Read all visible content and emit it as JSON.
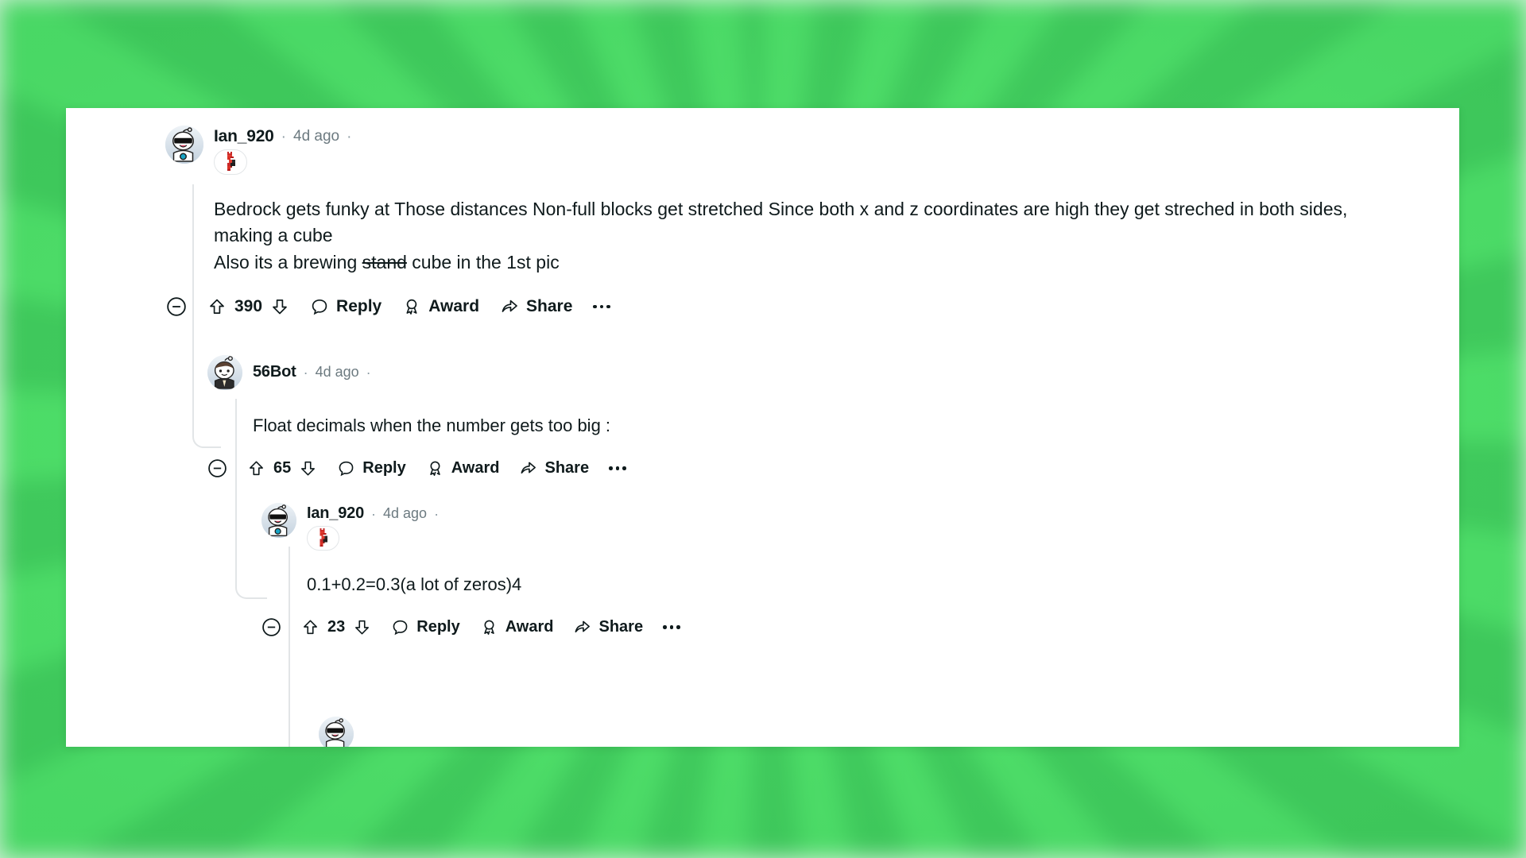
{
  "theme": {
    "background_color": "#41c95d",
    "card_color": "#ffffff",
    "text_color": "#0f1a1c",
    "muted_text_color": "#6c7a80",
    "thread_line_color": "#e2e5e7"
  },
  "comments": [
    {
      "id": "comment-1",
      "author": "Ian_920",
      "separator": "·",
      "timestamp": "4d ago",
      "trailing_separator": "·",
      "flair_icon": "minecraft-redstone-torch-icon",
      "avatar_icon": "snoo-sunglasses-avatar",
      "paragraphs": [
        {
          "before": "Bedrock gets funky at Those distances Non-full blocks get stretched Since both x and z coordinates are high they get streched in both sides, making a cube",
          "struck": "",
          "after": ""
        },
        {
          "before": "Also its a brewing ",
          "struck": "stand",
          "after": " cube in the 1st pic"
        }
      ],
      "actions": {
        "collapse_icon": "minus-circle-icon",
        "upvote_icon": "upvote-arrow-icon",
        "score": "390",
        "downvote_icon": "downvote-arrow-icon",
        "reply_icon": "comment-bubble-icon",
        "reply_label": "Reply",
        "award_icon": "award-ribbon-icon",
        "award_label": "Award",
        "share_icon": "share-arrow-icon",
        "share_label": "Share",
        "more_icon": "more-horizontal-icon"
      }
    },
    {
      "id": "comment-2",
      "author": "56Bot",
      "separator": "·",
      "timestamp": "4d ago",
      "trailing_separator": "·",
      "flair_icon": "",
      "avatar_icon": "snoo-brown-hair-avatar",
      "paragraphs": [
        {
          "before": "Float decimals when the number gets too big :",
          "struck": "",
          "after": ""
        }
      ],
      "actions": {
        "collapse_icon": "minus-circle-icon",
        "upvote_icon": "upvote-arrow-icon",
        "score": "65",
        "downvote_icon": "downvote-arrow-icon",
        "reply_icon": "comment-bubble-icon",
        "reply_label": "Reply",
        "award_icon": "award-ribbon-icon",
        "award_label": "Award",
        "share_icon": "share-arrow-icon",
        "share_label": "Share",
        "more_icon": "more-horizontal-icon"
      }
    },
    {
      "id": "comment-3",
      "author": "Ian_920",
      "separator": "·",
      "timestamp": "4d ago",
      "trailing_separator": "·",
      "flair_icon": "minecraft-redstone-torch-icon",
      "avatar_icon": "snoo-sunglasses-avatar",
      "paragraphs": [
        {
          "before": "0.1+0.2=0.3(a lot of zeros)4",
          "struck": "",
          "after": ""
        }
      ],
      "actions": {
        "collapse_icon": "minus-circle-icon",
        "upvote_icon": "upvote-arrow-icon",
        "score": "23",
        "downvote_icon": "downvote-arrow-icon",
        "reply_icon": "comment-bubble-icon",
        "reply_label": "Reply",
        "award_icon": "award-ribbon-icon",
        "award_label": "Award",
        "share_icon": "share-arrow-icon",
        "share_label": "Share",
        "more_icon": "more-horizontal-icon"
      }
    }
  ],
  "partial_comment": {
    "id": "comment-4-partial",
    "avatar_icon": "snoo-sunglasses-avatar"
  }
}
